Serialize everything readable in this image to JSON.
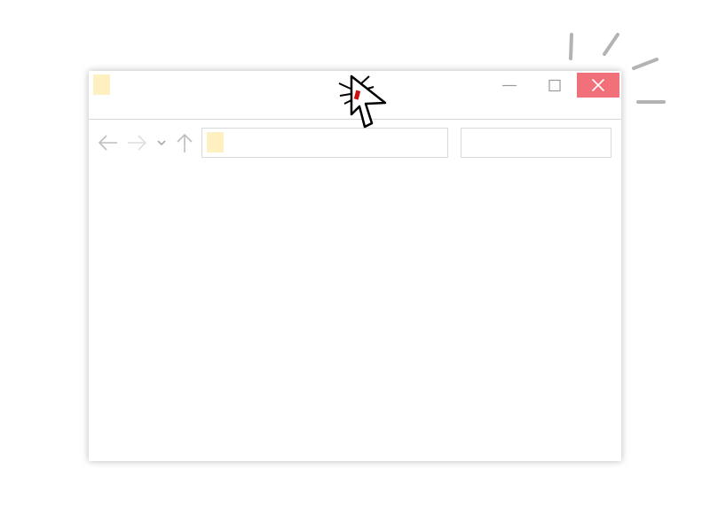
{
  "window": {
    "title": "",
    "controls": {
      "minimize_icon": "minimize-icon",
      "maximize_icon": "maximize-icon",
      "close_icon": "close-icon",
      "close_hover_color": "#f1707a"
    }
  },
  "toolbar": {
    "back_icon": "arrow-left-icon",
    "forward_icon": "arrow-right-icon",
    "recent_icon": "chevron-down-icon",
    "up_icon": "arrow-up-icon",
    "address": {
      "folder_icon": "folder-icon",
      "path": ""
    },
    "search": {
      "placeholder": "",
      "value": ""
    }
  },
  "content": {
    "items": []
  },
  "overlay": {
    "cursor_icon": "pointer-cursor-icon",
    "click_indicator_icon": "click-burst-icon",
    "cursor_accent_color": "#cc1111",
    "burst_color": "#b3b3b3"
  },
  "colors": {
    "folder_placeholder": "#fff0c2",
    "nav_glyph": "#c8c8c8",
    "border": "#d9d9d9"
  }
}
